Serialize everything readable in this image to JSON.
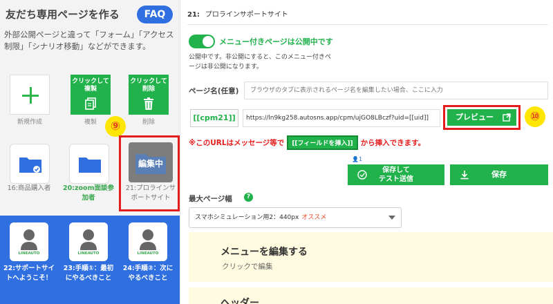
{
  "sidebar": {
    "title": "友だち専用ページを作る",
    "faq_label": "FAQ",
    "description": "外部公開ページと違って「フォーム」「アクセス制限」「シナリオ移動」などができます。",
    "tools": [
      {
        "label": "新規作成",
        "caption": ""
      },
      {
        "label": "複製",
        "caption": "クリックして複製"
      },
      {
        "label": "削除",
        "caption": "クリックして削除"
      }
    ],
    "annotation_9": "⑨",
    "pages": [
      {
        "label": "16:商品購入者"
      },
      {
        "label": "20:zoom面談参加者"
      },
      {
        "label": "21:プロラインサポートサイト",
        "overlay": "編集中"
      }
    ],
    "auto_pages": [
      {
        "label": "22:サポートサイトへようこそ！",
        "brand": "LINEAUTO"
      },
      {
        "label": "23:手順①：最初にやるべきこと",
        "brand": "LINEAUTO"
      },
      {
        "label": "24:手順②：次にやるべきこと",
        "brand": "LINEAUTO"
      }
    ]
  },
  "editor": {
    "page_id": "21:",
    "page_title_value": "プロラインサポートサイト",
    "publish_status": "メニュー付きページは公開中です",
    "publish_help": "公開中です。非公開にすると、このメニュー付きページは非公開になります。",
    "page_name_label": "ページ名(任意)",
    "page_name_placeholder": "ブラウザのタブに表示されるページ名を編集したい場合、ここに入力",
    "cpm_tag": "[[cpm21]]",
    "url": "https://ln9kg258.autosns.app/cpm/ujGO8LBczf?uid=[[uid]]",
    "preview_label": "プレビュー",
    "annotation_10": "⑩",
    "notice_prefix": "※このURLはメッセージ等で",
    "notice_button": "[[フィールドを挿入]]",
    "notice_suffix": "から挿入できます。",
    "user_count": "1",
    "save_test_label_1": "保存して",
    "save_test_label_2": "テスト送信",
    "save_label": "保存",
    "max_width_label": "最大ページ幅",
    "max_width_value": "スマホシミュレーション用2：440px",
    "max_width_rec": "オススメ",
    "menu_edit_title": "メニューを編集する",
    "menu_edit_sub": "クリックで編集",
    "header_title": "ヘッダー"
  },
  "colors": {
    "green": "#21b24b",
    "blue": "#2f6fe0",
    "red": "#e51c1c",
    "yellow": "#ffe600"
  }
}
